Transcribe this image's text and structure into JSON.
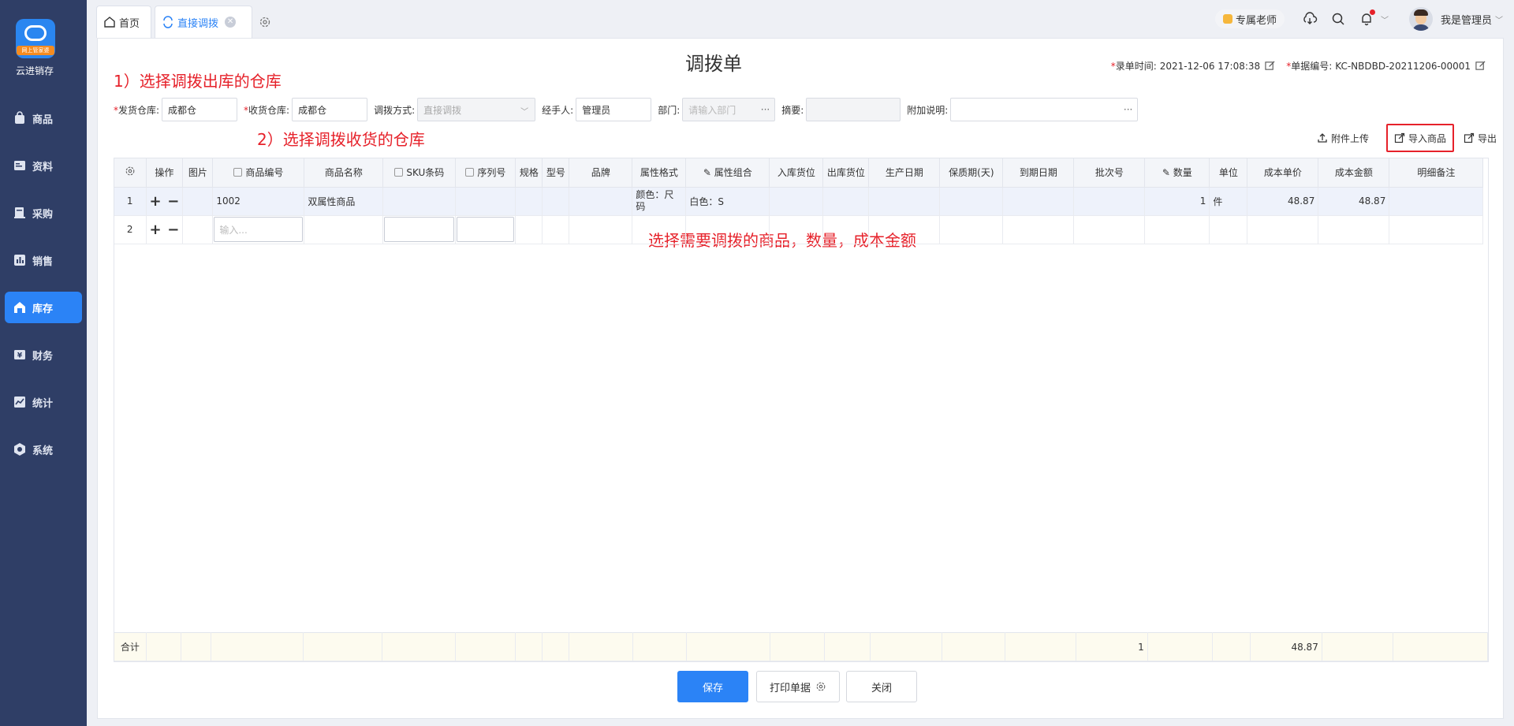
{
  "sidebar": {
    "logo_badge": "网上管家婆",
    "app_name": "云进销存",
    "items": [
      {
        "label": "商品",
        "icon": "bag-icon",
        "active": false
      },
      {
        "label": "资料",
        "icon": "document-icon",
        "active": false
      },
      {
        "label": "采购",
        "icon": "purchase-icon",
        "active": false
      },
      {
        "label": "销售",
        "icon": "chart-bar-icon",
        "active": false
      },
      {
        "label": "库存",
        "icon": "warehouse-icon",
        "active": true
      },
      {
        "label": "财务",
        "icon": "finance-icon",
        "active": false
      },
      {
        "label": "统计",
        "icon": "stats-icon",
        "active": false
      },
      {
        "label": "系统",
        "icon": "hexagon-gear-icon",
        "active": false
      }
    ]
  },
  "tabs": {
    "home": "首页",
    "current": "直接调拨"
  },
  "header_right": {
    "teacher": "专属老师",
    "username": "我是管理员"
  },
  "page": {
    "title": "调拨单",
    "entry_time_label": "录单时间:",
    "entry_time": "2021-12-06 17:08:38",
    "doc_no_label": "单据编号:",
    "doc_no": "KC-NBDBD-20211206-00001"
  },
  "annotations": {
    "step1": "1）选择调拨出库的仓库",
    "step2": "2）选择调拨收货的仓库",
    "step3": "选择需要调拨的商品，数量，成本金额"
  },
  "form": {
    "from_wh_label": "发货仓库:",
    "from_wh_value": "成都仓",
    "to_wh_label": "收货仓库:",
    "to_wh_value": "成都仓",
    "method_label": "调拨方式:",
    "method_value": "直接调拨",
    "handler_label": "经手人:",
    "handler_value": "管理员",
    "dept_label": "部门:",
    "dept_placeholder": "请输入部门",
    "summary_label": "摘要:",
    "summary_value": "",
    "note_label": "附加说明:",
    "note_value": ""
  },
  "toolbar": {
    "upload": "附件上传",
    "import": "导入商品",
    "export": "导出"
  },
  "table": {
    "columns": [
      "操作",
      "图片",
      "商品编号",
      "商品名称",
      "SKU条码",
      "序列号",
      "规格",
      "型号",
      "品牌",
      "属性格式",
      "属性组合",
      "入库货位",
      "出库货位",
      "生产日期",
      "保质期(天)",
      "到期日期",
      "批次号",
      "数量",
      "单位",
      "成本单价",
      "成本金额",
      "明细备注"
    ],
    "rows": [
      {
        "no": "1",
        "code": "1002",
        "name": "双属性商品",
        "attr_format": "颜色：尺码",
        "attr_combo": "白色：S",
        "qty": "1",
        "unit": "件",
        "unit_cost": "48.87",
        "amount": "48.87"
      }
    ],
    "input_row": {
      "no": "2",
      "placeholder": "输入..."
    },
    "total": {
      "label": "合计",
      "qty": "1",
      "amount": "48.87"
    }
  },
  "footer": {
    "save": "保存",
    "print": "打印单据",
    "close": "关闭"
  },
  "colors": {
    "sidebar_bg": "#2f3e66",
    "accent": "#2b83f6",
    "annotation": "#e6212a"
  }
}
